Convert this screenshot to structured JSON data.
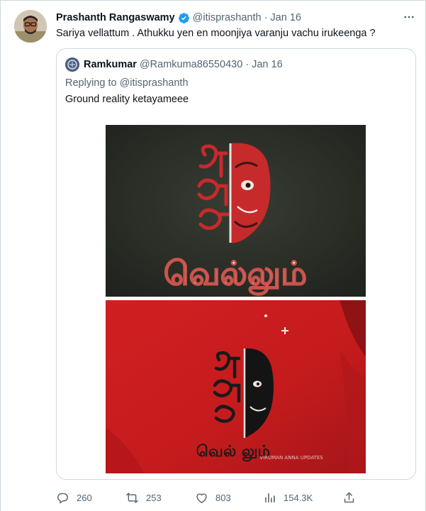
{
  "tweet": {
    "author_name": "Prashanth Rangaswamy",
    "author_handle": "@itisprashanth",
    "separator": "·",
    "date": "Jan 16",
    "text": "Sariya vellattum . Athukku yen en moonjiya varanju vachu irukeenga ?"
  },
  "quoted_tweet": {
    "author_name": "Ramkumar",
    "author_handle": "@Ramkuma86550430",
    "separator": "·",
    "date": "Jan 16",
    "replying_prefix": "Replying to ",
    "replying_to": "@itisprashanth",
    "text": "Ground reality ketayameee",
    "media": {
      "top_art_main": "வெல்லும்",
      "bottom_art_main": "வெல் லும்",
      "watermark": "VIRUMAN ANNA UPDATES"
    }
  },
  "actions": {
    "replies": "260",
    "retweets": "253",
    "likes": "803",
    "views": "154.3K"
  },
  "colors": {
    "text_primary": "#0f1419",
    "text_secondary": "#536471",
    "verified_blue": "#1d9bf0",
    "border": "#cfd9de",
    "wall_dark": "#2f332c",
    "shirt_red": "#cf1d1f"
  },
  "icons": [
    "more-icon",
    "verified-icon",
    "reply-icon",
    "retweet-icon",
    "like-icon",
    "views-icon",
    "share-icon"
  ]
}
